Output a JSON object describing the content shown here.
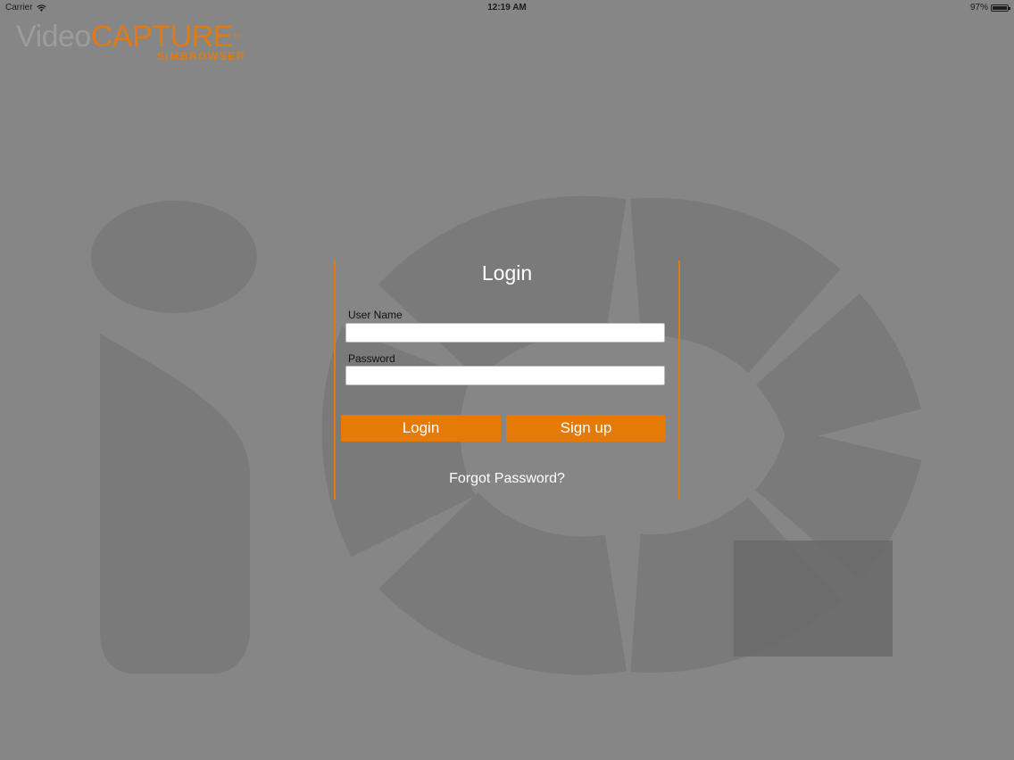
{
  "status_bar": {
    "carrier": "Carrier",
    "time": "12:19 AM",
    "battery": "97%",
    "battery_level": 0.97
  },
  "logo": {
    "part1": "Video",
    "part2": "CAPTURE",
    "tm": "™",
    "sub": "SiMBROWSER"
  },
  "login": {
    "title": "Login",
    "username_label": "User Name",
    "username_value": "",
    "password_label": "Password",
    "password_value": "",
    "login_button": "Login",
    "signup_button": "Sign up",
    "forgot_link": "Forgot Password?"
  },
  "colors": {
    "background": "#868686",
    "accent": "#e57a06",
    "watermark": "#7b7a7b"
  },
  "icons": {
    "wifi": "wifi-icon",
    "battery": "battery-icon",
    "watermark": "io-logo-watermark"
  }
}
